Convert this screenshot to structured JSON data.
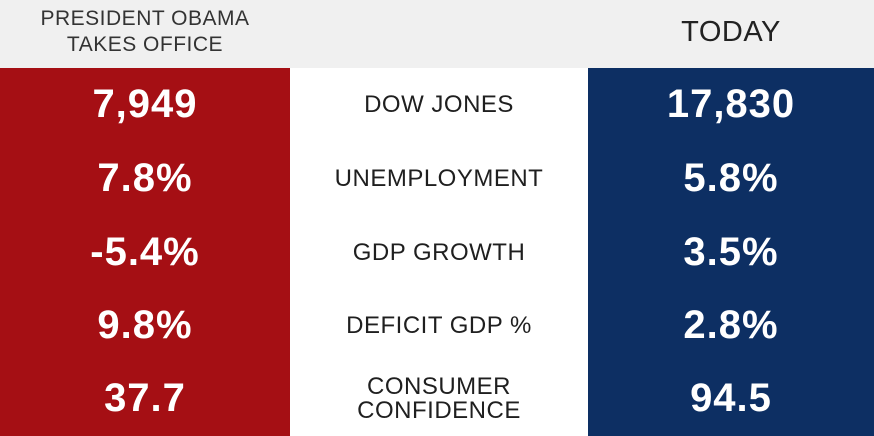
{
  "header": {
    "left_line1": "PRESIDENT OBAMA",
    "left_line2": "TAKES OFFICE",
    "right": "TODAY"
  },
  "colors": {
    "left_panel": "#a50f14",
    "right_panel": "#0d2f63",
    "header_bg": "#f0f0f0"
  },
  "rows": [
    {
      "label": "DOW JONES",
      "before": "7,949",
      "today": "17,830"
    },
    {
      "label": "UNEMPLOYMENT",
      "before": "7.8%",
      "today": "5.8%"
    },
    {
      "label": "GDP GROWTH",
      "before": "-5.4%",
      "today": "3.5%"
    },
    {
      "label": "DEFICIT GDP %",
      "before": "9.8%",
      "today": "2.8%"
    },
    {
      "label_line1": "CONSUMER",
      "label_line2": "CONFIDENCE",
      "before": "37.7",
      "today": "94.5"
    }
  ]
}
